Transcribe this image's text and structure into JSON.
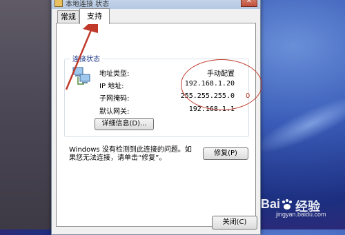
{
  "window": {
    "title": "本地连接 状态",
    "close_symbol": "✕"
  },
  "tabs": [
    {
      "label": "常规",
      "active": false
    },
    {
      "label": "支持",
      "active": true
    }
  ],
  "connection_status": {
    "group_label": "连接状态",
    "rows": [
      {
        "label": "地址类型:",
        "value": "手动配置"
      },
      {
        "label": "IP 地址:",
        "value": "192.168.1.20"
      },
      {
        "label": "子网掩码:",
        "value": "255.255.255.0"
      },
      {
        "label": "默认网关:",
        "value": "192.168.1.1"
      }
    ],
    "details_button": "详细信息(D)..."
  },
  "repair": {
    "description": "Windows 没有检测到此连接的问题。如果您无法连接，请单击“修复”。",
    "button": "修复(P)"
  },
  "footer": {
    "close_button": "关闭(C)"
  },
  "annotations": {
    "mark": "0",
    "accent_color": "#c0392b"
  },
  "watermark": {
    "brand": "Bai",
    "brand_suffix": "经验",
    "url": "jingyan.baidu.com"
  }
}
